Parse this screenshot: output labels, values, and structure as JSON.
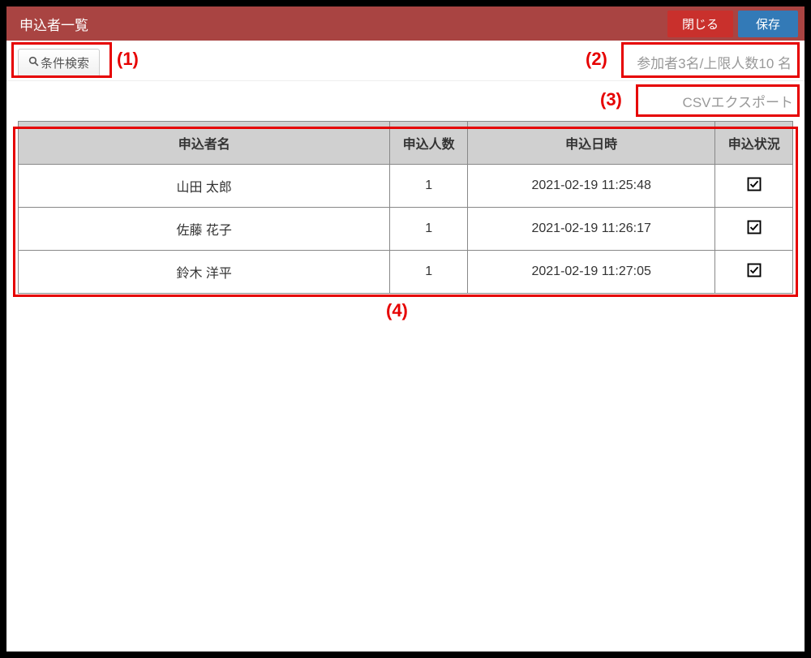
{
  "header": {
    "title": "申込者一覧",
    "close_label": "閉じる",
    "save_label": "保存"
  },
  "top": {
    "search_label": "条件検索",
    "count_text": "参加者3名/上限人数10 名",
    "csv_label": "CSVエクスポート"
  },
  "table": {
    "headers": {
      "name": "申込者名",
      "num": "申込人数",
      "date": "申込日時",
      "status": "申込状況"
    },
    "rows": [
      {
        "name": "山田 太郎",
        "num": "1",
        "date": "2021-02-19 11:25:48",
        "checked": true
      },
      {
        "name": "佐藤 花子",
        "num": "1",
        "date": "2021-02-19 11:26:17",
        "checked": true
      },
      {
        "name": "鈴木 洋平",
        "num": "1",
        "date": "2021-02-19 11:27:05",
        "checked": true
      }
    ]
  },
  "annotations": {
    "a1": "(1)",
    "a2": "(2)",
    "a3": "(3)",
    "a4": "(4)"
  }
}
